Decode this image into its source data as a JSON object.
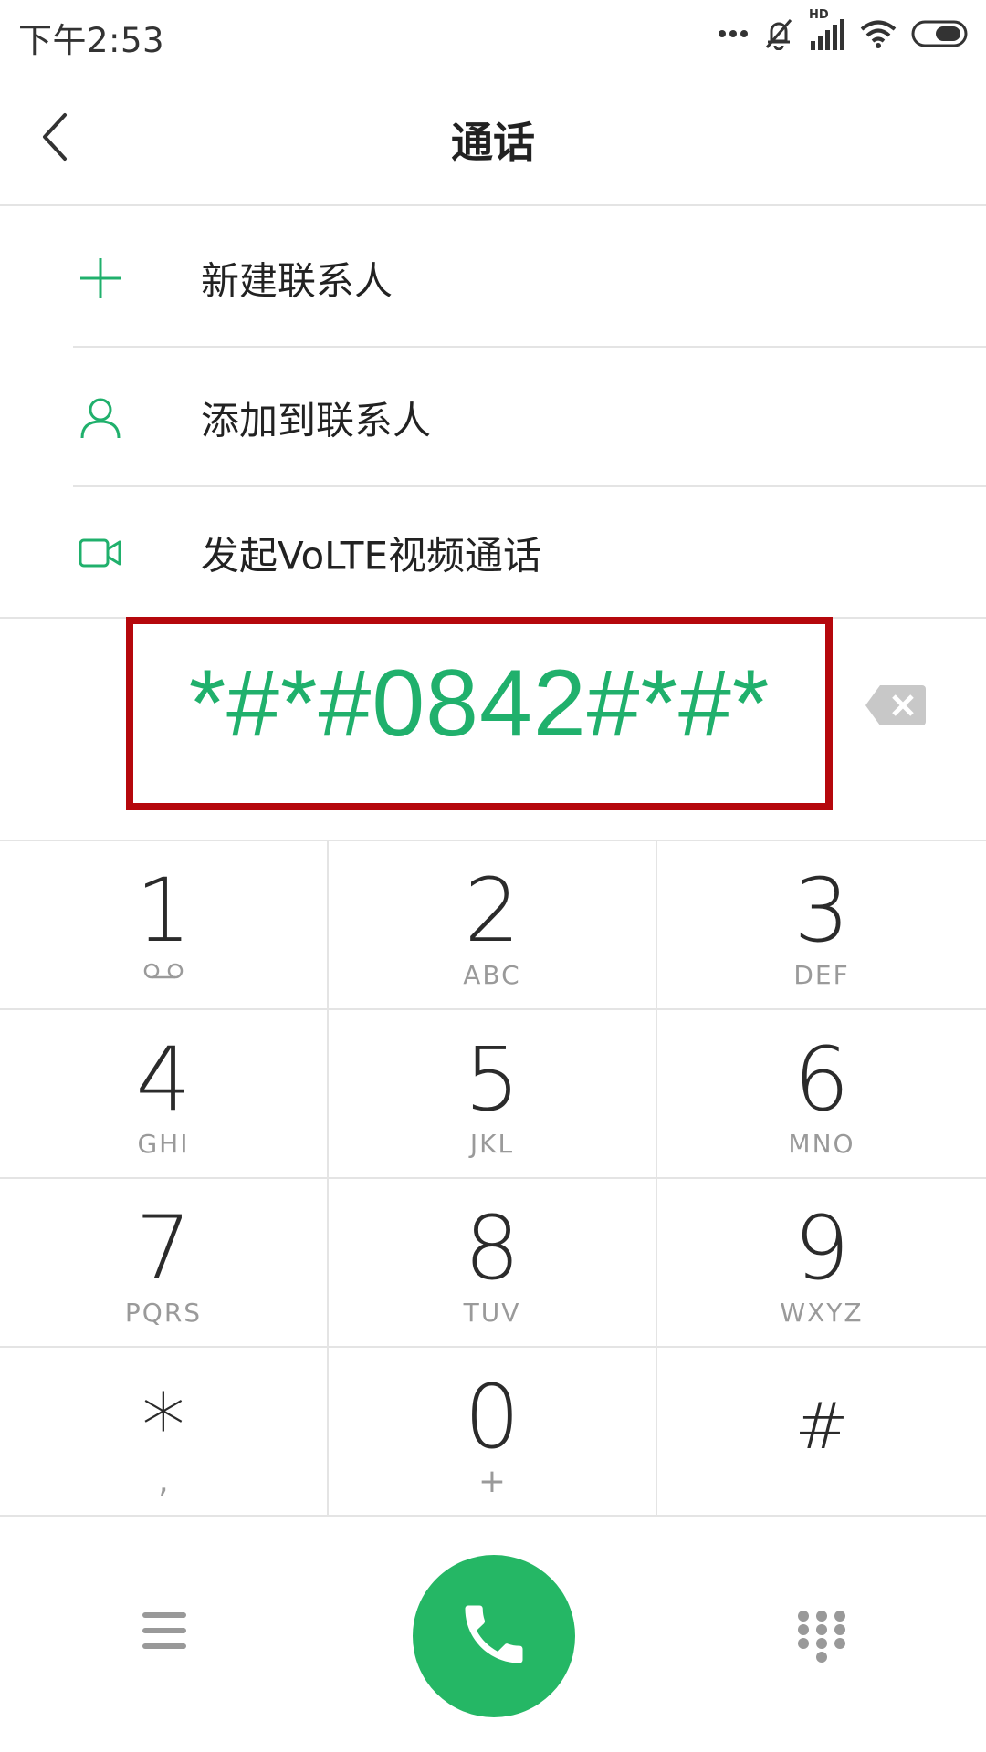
{
  "status_bar": {
    "time": "下午2:53",
    "icons": [
      "more-dots-icon",
      "mute-bell-icon",
      "hd-signal-icon",
      "wifi-icon",
      "battery-icon"
    ],
    "hd_label": "HD"
  },
  "header": {
    "title": "通话",
    "back_icon": "chevron-left-icon"
  },
  "actions": [
    {
      "icon": "plus-icon",
      "label": "新建联系人"
    },
    {
      "icon": "person-icon",
      "label": "添加到联系人"
    },
    {
      "icon": "video-camera-icon",
      "label": "发起VoLTE视频通话"
    }
  ],
  "dial": {
    "number": "*#*#0842#*#*",
    "backspace_icon": "backspace-icon"
  },
  "keypad": {
    "keys": [
      {
        "digit": "1",
        "letters": "",
        "sub_icon": "voicemail-icon"
      },
      {
        "digit": "2",
        "letters": "ABC"
      },
      {
        "digit": "3",
        "letters": "DEF"
      },
      {
        "digit": "4",
        "letters": "GHI"
      },
      {
        "digit": "5",
        "letters": "JKL"
      },
      {
        "digit": "6",
        "letters": "MNO"
      },
      {
        "digit": "7",
        "letters": "PQRS"
      },
      {
        "digit": "8",
        "letters": "TUV"
      },
      {
        "digit": "9",
        "letters": "WXYZ"
      },
      {
        "digit": "*",
        "letters": ","
      },
      {
        "digit": "0",
        "letters": "+"
      },
      {
        "digit": "#",
        "letters": ""
      }
    ]
  },
  "bottom_bar": {
    "menu_icon": "hamburger-menu-icon",
    "call_icon": "phone-icon",
    "dialpad_icon": "dialpad-icon"
  },
  "colors": {
    "accent_green": "#20b06c",
    "call_button": "#25b765",
    "highlight_border": "#b5070c",
    "divider": "#e4e4e4",
    "secondary_text": "#9a9a9a"
  }
}
